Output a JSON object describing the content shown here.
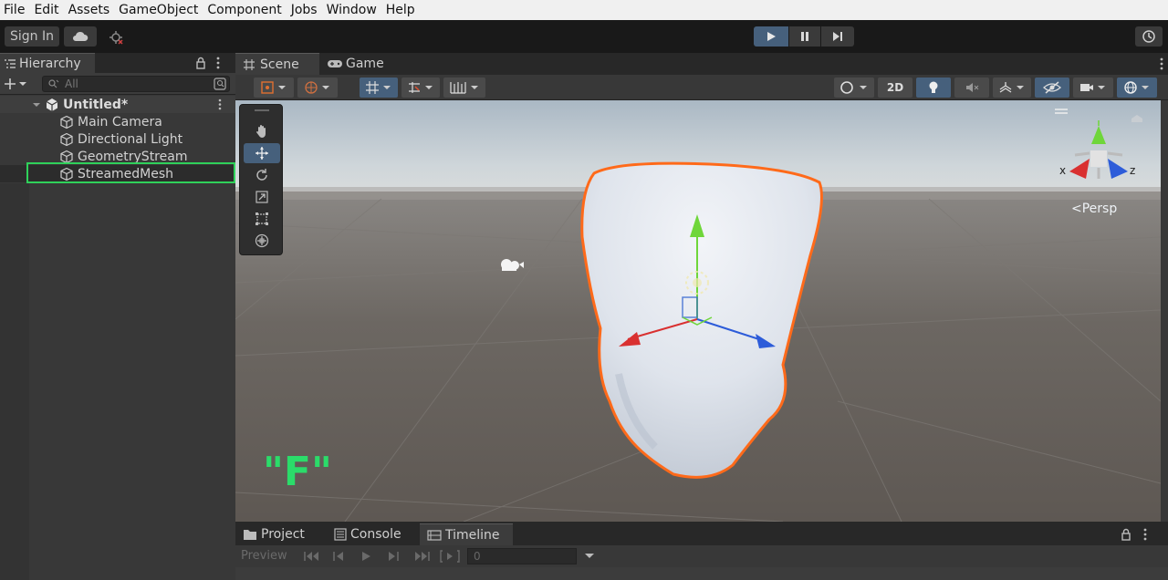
{
  "menu": [
    "File",
    "Edit",
    "Assets",
    "GameObject",
    "Component",
    "Jobs",
    "Window",
    "Help"
  ],
  "toolbar": {
    "sign_in": "Sign In"
  },
  "hierarchy": {
    "tab_label": "Hierarchy",
    "search_placeholder": "All",
    "scene_name": "Untitled*",
    "items": [
      "Main Camera",
      "Directional Light",
      "GeometryStream",
      "StreamedMesh"
    ]
  },
  "scene_tabs": {
    "scene": "Scene",
    "game": "Game"
  },
  "scene_toolbar": {
    "mode_2d": "2D"
  },
  "viewport": {
    "persp_label": "<Persp",
    "axis_x": "x",
    "axis_z": "z",
    "key_hint": "\"F\""
  },
  "bottom_tabs": {
    "project": "Project",
    "console": "Console",
    "timeline": "Timeline"
  },
  "timeline": {
    "preview": "Preview",
    "frame": "0"
  },
  "colors": {
    "selection_outline": "#ff6a1a",
    "highlight_box": "#2fd15a",
    "key_hint": "#2bdc6a",
    "play_active": "#46607c"
  }
}
